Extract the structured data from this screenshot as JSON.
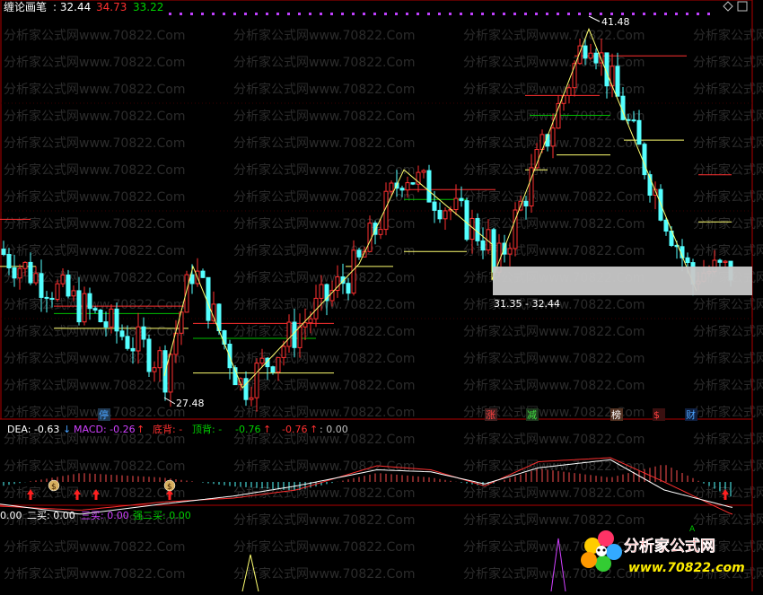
{
  "header": {
    "indicator_name": "缠论画笔",
    "values": [
      {
        "text": ": 32.44",
        "color": "#ffffff"
      },
      {
        "text": "34.73",
        "color": "#ff3030"
      },
      {
        "text": "33.22",
        "color": "#00d000"
      }
    ]
  },
  "watermark": {
    "text": "分析家公式网www.70822.Com",
    "rows": 22
  },
  "price_annotations": {
    "high": "41.48",
    "low": "27.48",
    "readout": "31.35 - 32.44"
  },
  "signal_labels": [
    {
      "text": "停",
      "color": "#4aa3ff",
      "bg": "#203850"
    },
    {
      "text": "涨",
      "color": "#ff4040",
      "bg": "#402020"
    },
    {
      "text": "减",
      "color": "#40e040",
      "bg": "#203820"
    },
    {
      "text": "榜",
      "color": "#ffffff",
      "bg": "#503020"
    },
    {
      "text": "$",
      "color": "#ff4040",
      "bg": "#3a1010"
    },
    {
      "text": "财",
      "color": "#4aa3ff",
      "bg": "#102040"
    }
  ],
  "macd_legend": [
    {
      "text": "DEA: -0.63",
      "color": "#ffffff"
    },
    {
      "text": "↓",
      "color": "#4aa3ff"
    },
    {
      "text": "MACD: -0.26",
      "color": "#d040ff"
    },
    {
      "text": "↑",
      "color": "#ff3030"
    },
    {
      "text": "底背: -",
      "color": "#ff3030"
    },
    {
      "text": "顶背: -",
      "color": "#00d000"
    },
    {
      "text": "-0.76",
      "color": "#00d000"
    },
    {
      "text": "↑",
      "color": "#ff3030"
    },
    {
      "text": "-0.76",
      "color": "#ff3030"
    },
    {
      "text": "↑",
      "color": "#ff3030"
    },
    {
      "text": ": 0.00",
      "color": "#c0c0c0"
    }
  ],
  "macd_markers": {
    "money_bag": "$"
  },
  "buy_legend": [
    {
      "text": "0.00",
      "color": "#ffffff"
    },
    {
      "text": "二买: 0.00",
      "color": "#ffffff"
    },
    {
      "text": "三买: 0.00",
      "color": "#d040ff"
    },
    {
      "text": "强二买: 0.00",
      "color": "#00d000"
    }
  ],
  "bottom_marker": "A",
  "logo": {
    "text": "分析家公式网",
    "url": "www.70822.com"
  },
  "chart_data": [
    {
      "type": "candlestick",
      "title": "",
      "ylim": [
        26.5,
        42.0
      ],
      "stroke_points": [
        27.48,
        31.9,
        27.0,
        32.0,
        35.8,
        32.8,
        31.35,
        41.48,
        30.9
      ],
      "annotations": [
        "41.48",
        "27.48",
        "31.35 - 32.44"
      ]
    },
    {
      "type": "line",
      "title": "",
      "series": [
        {
          "values": [
            -0.55,
            -0.8,
            -0.55,
            -0.35,
            -0.1,
            0.3,
            0.25,
            -0.05,
            0.35,
            0.55,
            -0.2,
            -0.63
          ]
        },
        {
          "values": [
            -0.6,
            -0.7,
            -0.5,
            -0.4,
            -0.2,
            0.4,
            0.3,
            -0.1,
            0.5,
            0.6,
            0.0,
            -0.8
          ]
        }
      ],
      "values_readout": {
        "DEA": -0.63,
        "MACD": -0.26
      }
    }
  ]
}
